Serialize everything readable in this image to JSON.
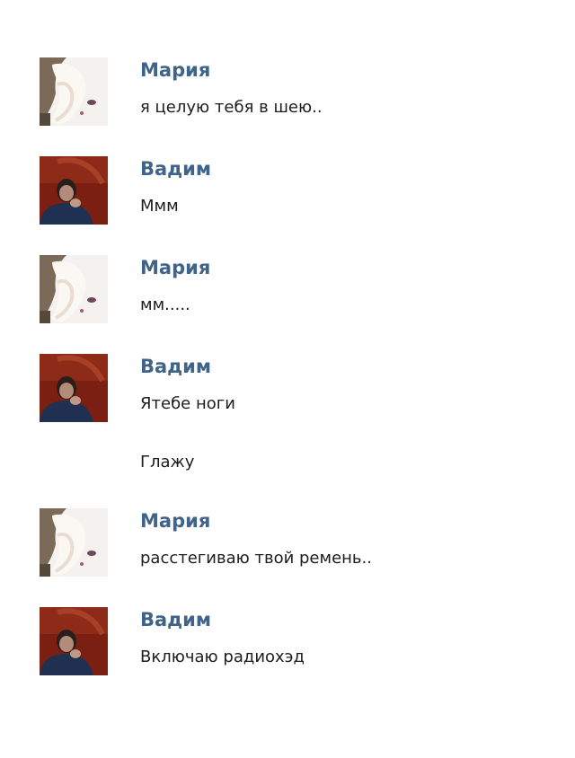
{
  "messages": [
    {
      "author": "Мария",
      "avatar_icon": "maria-avatar",
      "lines": [
        "я целую тебя в шею.."
      ]
    },
    {
      "author": "Вадим",
      "avatar_icon": "vadim-avatar",
      "lines": [
        "Ммм"
      ]
    },
    {
      "author": "Мария",
      "avatar_icon": "maria-avatar",
      "lines": [
        "мм....."
      ]
    },
    {
      "author": "Вадим",
      "avatar_icon": "vadim-avatar",
      "lines": [
        "Ятебе ноги",
        "Глажу"
      ]
    },
    {
      "author": "Мария",
      "avatar_icon": "maria-avatar",
      "lines": [
        "расстегиваю твой ремень.."
      ]
    },
    {
      "author": "Вадим",
      "avatar_icon": "vadim-avatar",
      "lines": [
        "Включаю радиохэд"
      ]
    }
  ],
  "colors": {
    "author": "#3f6389",
    "text": "#1d1d1d",
    "background": "#ffffff"
  }
}
